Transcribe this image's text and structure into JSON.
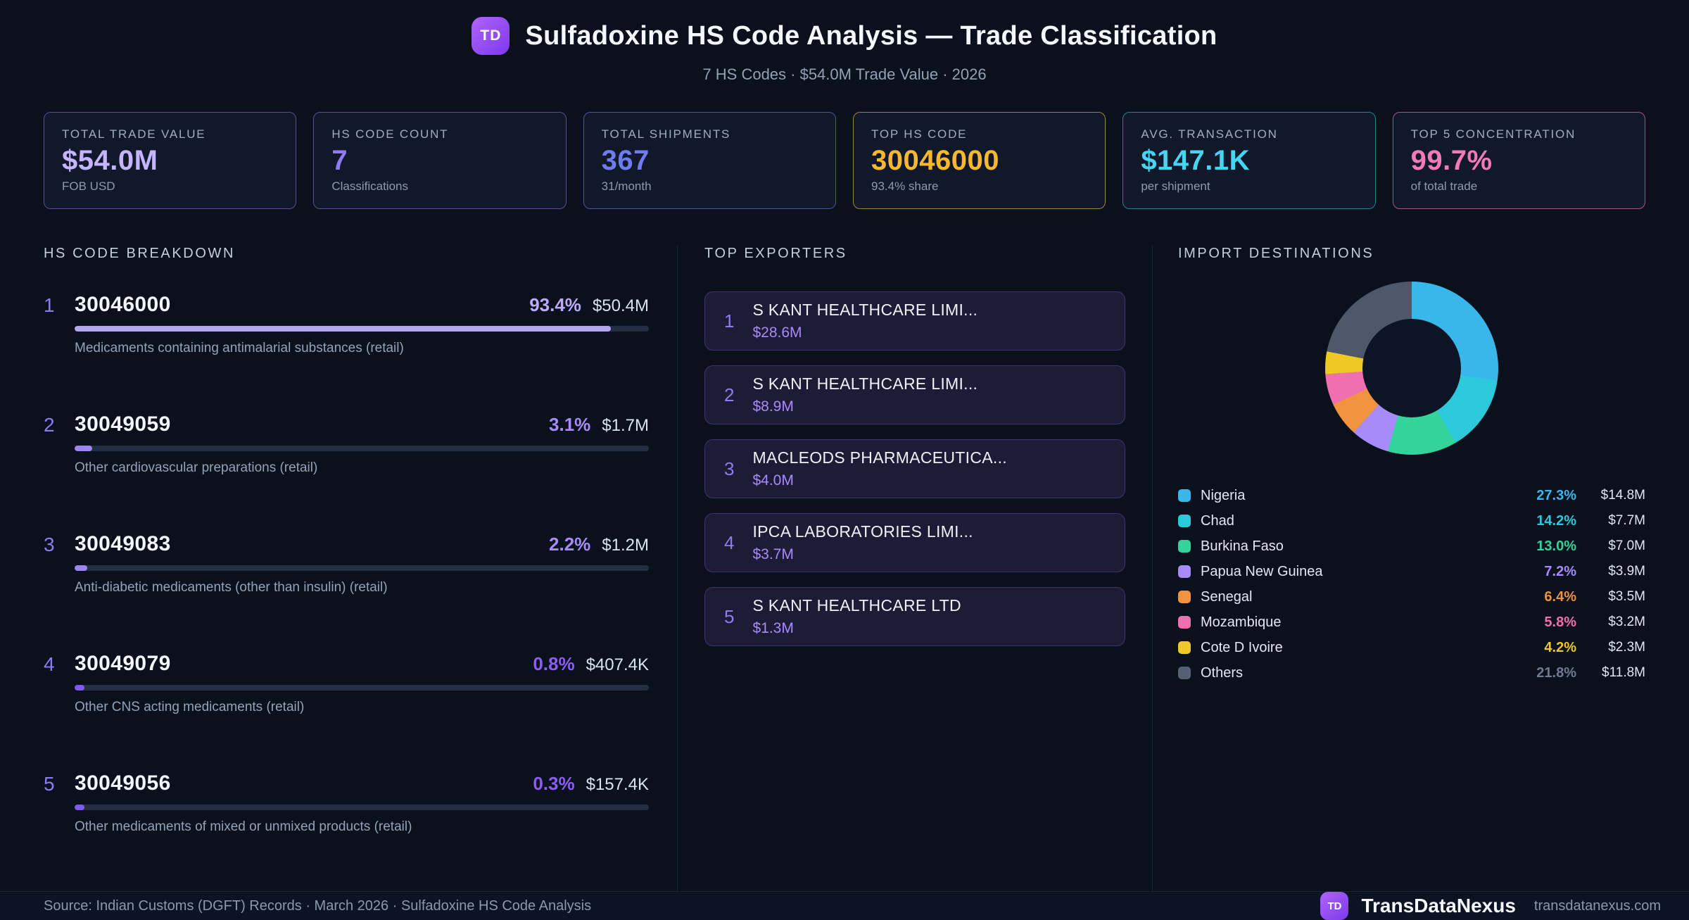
{
  "header": {
    "logo": "TD",
    "title": "Sulfadoxine HS Code Analysis — Trade Classification",
    "subtitle": "7 HS Codes · $54.0M Trade Value · 2026"
  },
  "stats": [
    {
      "label": "TOTAL TRADE VALUE",
      "value": "$54.0M",
      "sub": "FOB USD",
      "accent": "#c4b5fd",
      "border": "#5d4d96"
    },
    {
      "label": "HS CODE COUNT",
      "value": "7",
      "sub": "Classifications",
      "accent": "#8f7cf2",
      "border": "#5d4d96"
    },
    {
      "label": "TOTAL SHIPMENTS",
      "value": "367",
      "sub": "31/month",
      "accent": "#6f7cf0",
      "border": "#4a55a0"
    },
    {
      "label": "TOP HS CODE",
      "value": "30046000",
      "sub": "93.4% share",
      "accent": "#f5b82e",
      "border": "#9a8435"
    },
    {
      "label": "AVG. TRANSACTION",
      "value": "$147.1K",
      "sub": "per shipment",
      "accent": "#45d5f2",
      "border": "#2d7e95"
    },
    {
      "label": "TOP 5 CONCENTRATION",
      "value": "99.7%",
      "sub": "of total trade",
      "accent": "#f27ab8",
      "border": "#a65583"
    }
  ],
  "breakdown": {
    "title": "HS CODE BREAKDOWN",
    "items": [
      {
        "rank": "1",
        "code": "30046000",
        "pct": "93.4%",
        "pct_num": 93.4,
        "value": "$50.4M",
        "desc": "Medicaments containing antimalarial substances (retail)",
        "pct_color": "#bcaaf7",
        "bar_color": "#b4a6ee"
      },
      {
        "rank": "2",
        "code": "30049059",
        "pct": "3.1%",
        "pct_num": 3.1,
        "value": "$1.7M",
        "desc": "Other cardiovascular preparations (retail)",
        "pct_color": "#a78bfa",
        "bar_color": "#9c86f0"
      },
      {
        "rank": "3",
        "code": "30049083",
        "pct": "2.2%",
        "pct_num": 2.2,
        "value": "$1.2M",
        "desc": "Anti-diabetic medicaments (other than insulin) (retail)",
        "pct_color": "#a78bfa",
        "bar_color": "#9c86f0"
      },
      {
        "rank": "4",
        "code": "30049079",
        "pct": "0.8%",
        "pct_num": 0.8,
        "value": "$407.4K",
        "desc": "Other CNS acting medicaments (retail)",
        "pct_color": "#8b5cf6",
        "bar_color": "#7e5af0"
      },
      {
        "rank": "5",
        "code": "30049056",
        "pct": "0.3%",
        "pct_num": 0.3,
        "value": "$157.4K",
        "desc": "Other medicaments of mixed or unmixed products (retail)",
        "pct_color": "#8b5cf6",
        "bar_color": "#7e5af0"
      }
    ]
  },
  "exporters": {
    "title": "TOP EXPORTERS",
    "items": [
      {
        "rank": "1",
        "name": "S KANT HEALTHCARE LIMI...",
        "value": "$28.6M"
      },
      {
        "rank": "2",
        "name": "S KANT HEALTHCARE LIMI...",
        "value": "$8.9M"
      },
      {
        "rank": "3",
        "name": "MACLEODS PHARMACEUTICA...",
        "value": "$4.0M"
      },
      {
        "rank": "4",
        "name": "IPCA LABORATORIES LIMI...",
        "value": "$3.7M"
      },
      {
        "rank": "5",
        "name": "S KANT HEALTHCARE LTD",
        "value": "$1.3M"
      }
    ]
  },
  "destinations": {
    "title": "IMPORT DESTINATIONS",
    "legend": [
      {
        "label": "Nigeria",
        "pct": "27.3%",
        "value": "$14.8M",
        "color": "#3ab7ea",
        "pct_color": "#3ab7ea"
      },
      {
        "label": "Chad",
        "pct": "14.2%",
        "value": "$7.7M",
        "color": "#2cc9dc",
        "pct_color": "#2cc9dc"
      },
      {
        "label": "Burkina Faso",
        "pct": "13.0%",
        "value": "$7.0M",
        "color": "#34d39b",
        "pct_color": "#34d39b"
      },
      {
        "label": "Papua New Guinea",
        "pct": "7.2%",
        "value": "$3.9M",
        "color": "#a78bfa",
        "pct_color": "#a78bfa"
      },
      {
        "label": "Senegal",
        "pct": "6.4%",
        "value": "$3.5M",
        "color": "#f0923e",
        "pct_color": "#f0923e"
      },
      {
        "label": "Mozambique",
        "pct": "5.8%",
        "value": "$3.2M",
        "color": "#f06fae",
        "pct_color": "#f06fae"
      },
      {
        "label": "Cote D Ivoire",
        "pct": "4.2%",
        "value": "$2.3M",
        "color": "#eec824",
        "pct_color": "#eec824"
      },
      {
        "label": "Others",
        "pct": "21.8%",
        "value": "$11.8M",
        "color": "#566073",
        "pct_color": "#6e7a8e"
      }
    ]
  },
  "chart_data": {
    "type": "pie",
    "donut": true,
    "title": "IMPORT DESTINATIONS",
    "labels": [
      "Nigeria",
      "Chad",
      "Burkina Faso",
      "Papua New Guinea",
      "Senegal",
      "Mozambique",
      "Cote D Ivoire",
      "Others"
    ],
    "values_pct": [
      27.3,
      14.2,
      13.0,
      7.2,
      6.4,
      5.8,
      4.2,
      21.8
    ],
    "amounts": [
      "$14.8M",
      "$7.7M",
      "$7.0M",
      "$3.9M",
      "$3.5M",
      "$3.2M",
      "$2.3M",
      "$11.8M"
    ],
    "colors": [
      "#3ab7ea",
      "#2cc9dc",
      "#34d39b",
      "#a78bfa",
      "#f0923e",
      "#f06fae",
      "#eec824",
      "#4d586a"
    ],
    "legend_position": "below",
    "start_angle_deg": 0
  },
  "footer": {
    "source": "Source: Indian Customs (DGFT) Records · March 2026 · Sulfadoxine HS Code Analysis",
    "logo": "TD",
    "brand": "TransDataNexus",
    "domain": "transdatanexus.com"
  }
}
